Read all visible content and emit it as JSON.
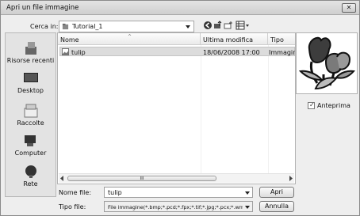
{
  "window": {
    "title": "Apri un file immagine",
    "close_label": "✕"
  },
  "lookin": {
    "label": "Cerca in:",
    "value": "Tutorial_1"
  },
  "toolbar": {
    "icons": [
      "back-icon",
      "up-folder-icon",
      "new-folder-icon",
      "view-menu-icon"
    ]
  },
  "places": [
    {
      "label": "Risorse recenti",
      "icon": "recent-places-icon"
    },
    {
      "label": "Desktop",
      "icon": "desktop-icon"
    },
    {
      "label": "Raccolte",
      "icon": "libraries-icon"
    },
    {
      "label": "Computer",
      "icon": "computer-icon"
    },
    {
      "label": "Rete",
      "icon": "network-icon"
    }
  ],
  "list": {
    "columns": [
      "Nome",
      "Ultima modifica",
      "Tipo"
    ],
    "rows": [
      {
        "name": "tulip",
        "date": "18/06/2008 17:00",
        "type": "Immagine"
      }
    ],
    "scroll_thumb_label": "III"
  },
  "preview": {
    "checkbox_label": "Anteprima",
    "checked": true,
    "check_mark": "✓"
  },
  "footer": {
    "filename_label": "Nome file:",
    "filename_value": "tulip",
    "filetype_label": "Tipo file:",
    "filetype_value": "File immagine(*.bmp;*.pcd;*.fpx;*.tif;*.jpg;*.pcx;*.wmf;*",
    "open_label": "Apri",
    "cancel_label": "Annulla"
  },
  "colors": {
    "selection": "#dcdcdc",
    "window_bg": "#eeeeee"
  }
}
